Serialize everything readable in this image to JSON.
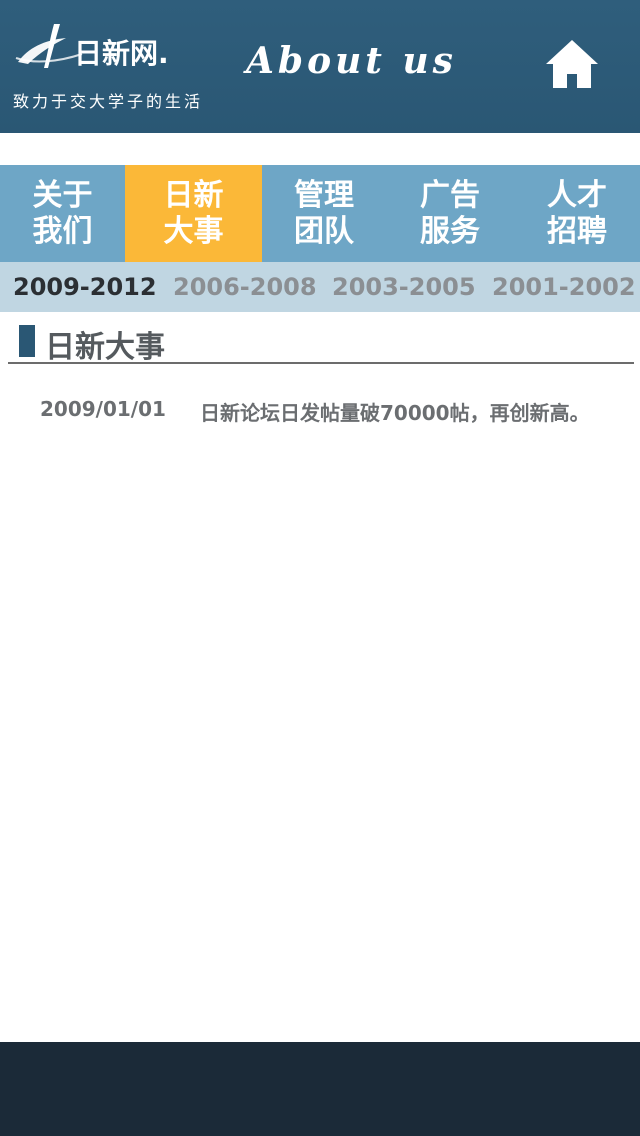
{
  "header": {
    "logo_text": "日新网.",
    "slogan": "致力于交大学子的生活",
    "page_heading": "About us",
    "home_icon": "home-icon",
    "background_color": "#2a5774"
  },
  "nav": {
    "items": [
      {
        "label": "关于\n我们",
        "active": false
      },
      {
        "label": "日新\n大事",
        "active": true
      },
      {
        "label": "管理\n团队",
        "active": false
      },
      {
        "label": "广告\n服务",
        "active": false
      },
      {
        "label": "人才\n招聘",
        "active": false
      }
    ],
    "background_color": "#6ea6c6",
    "active_color": "#fbb838"
  },
  "years": {
    "tabs": [
      {
        "label": "2009-2012",
        "active": true
      },
      {
        "label": "2006-2008",
        "active": false
      },
      {
        "label": "2003-2005",
        "active": false
      },
      {
        "label": "2001-2002",
        "active": false
      }
    ],
    "background_color": "#c0d6e2"
  },
  "section": {
    "title": "日新大事"
  },
  "events": [
    {
      "date": "2009/01/01",
      "text": "日新论坛日发帖量破70000帖，再创新高。"
    }
  ],
  "footer": {
    "background_color": "#1b2a38"
  }
}
